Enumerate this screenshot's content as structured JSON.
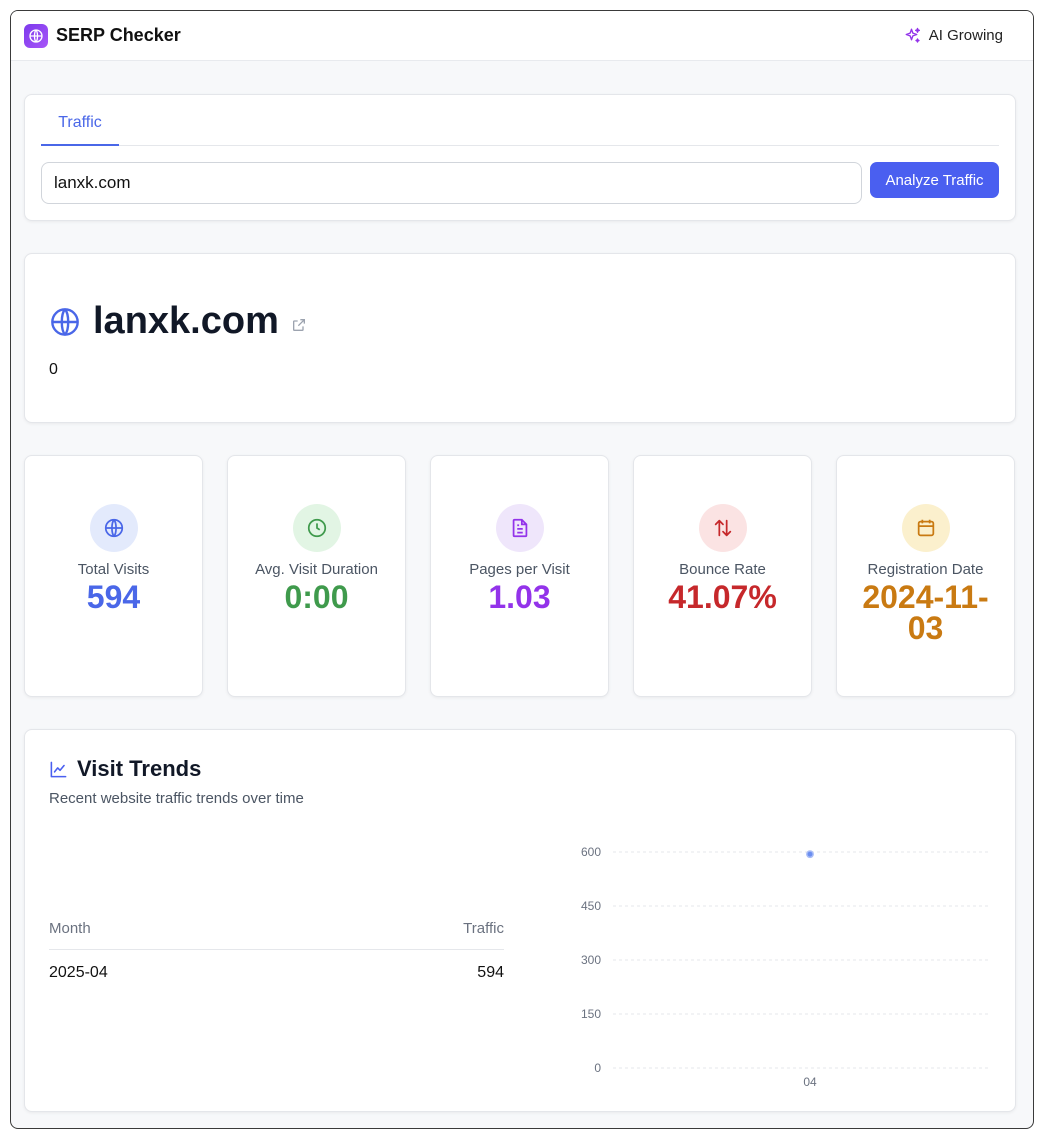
{
  "app": {
    "title": "SERP Checker",
    "ai_label": "AI Growing"
  },
  "search": {
    "tab": "Traffic",
    "input_value": "lanxk.com",
    "button_label": "Analyze Traffic"
  },
  "domain": {
    "name": "lanxk.com",
    "subvalue": "0"
  },
  "stats": [
    {
      "label": "Total Visits",
      "value": "594",
      "color": "#4a67e8",
      "bg": "#e3eafc",
      "icon": "globe-icon"
    },
    {
      "label": "Avg. Visit Duration",
      "value": "0:00",
      "color": "#3f9a4c",
      "bg": "#e2f5e4",
      "icon": "clock-icon"
    },
    {
      "label": "Pages per Visit",
      "value": "1.03",
      "color": "#9333ea",
      "bg": "#efe6fb",
      "icon": "document-icon"
    },
    {
      "label": "Bounce Rate",
      "value": "41.07%",
      "color": "#c6282b",
      "bg": "#fbe3e3",
      "icon": "arrows-up-down-icon"
    },
    {
      "label": "Registration Date",
      "value": "2024-11-03",
      "color": "#c97a12",
      "bg": "#fbf0cd",
      "icon": "calendar-icon"
    }
  ],
  "trends": {
    "title": "Visit Trends",
    "subtitle": "Recent website traffic trends over time",
    "table": {
      "headers": [
        "Month",
        "Traffic"
      ],
      "rows": [
        {
          "month": "2025-04",
          "traffic": "594"
        }
      ]
    }
  },
  "chart_data": {
    "type": "scatter",
    "x": [
      "04"
    ],
    "y": [
      594
    ],
    "ylim": [
      0,
      600
    ],
    "yticks": [
      0,
      150,
      300,
      450,
      600
    ],
    "grid": true,
    "color": "#6b8ef0"
  }
}
